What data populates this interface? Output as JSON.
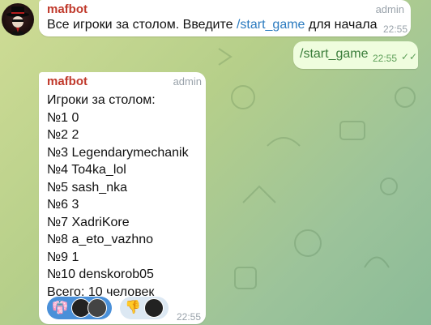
{
  "chat": {
    "messages": [
      {
        "sender": "mafbot",
        "role": "admin",
        "text_before": "Все игроки за столом. Введите ",
        "command": "/start_game",
        "text_after": " для начала",
        "time": "22:55"
      },
      {
        "outgoing": true,
        "text": "/start_game",
        "time": "22:55",
        "status": "read"
      },
      {
        "sender": "mafbot",
        "role": "admin",
        "lines": [
          "Игроки за столом:",
          "№1 0",
          "№2 2",
          "№3 Legendarymechanik",
          "№4 To4ka_lol",
          "№5 sash_nka",
          "№6 3",
          "№7 XadriKore",
          "№8 a_eto_vazhno",
          "№9 1",
          "№10 denskorob05",
          "Всего: 10 человек"
        ],
        "time": "22:55",
        "reactions": [
          {
            "emoji": "👘",
            "active": true,
            "icon": "kimono-emoji"
          },
          {
            "emoji": "👎",
            "active": false,
            "icon": "thumbs-down-emoji"
          }
        ]
      }
    ]
  },
  "colors": {
    "sender_name": "#c0392b",
    "command_link": "#2a7abf",
    "outgoing_bubble": "#effdde",
    "reaction_active": "#4a90d9",
    "reaction_inactive": "#dce8f3"
  }
}
